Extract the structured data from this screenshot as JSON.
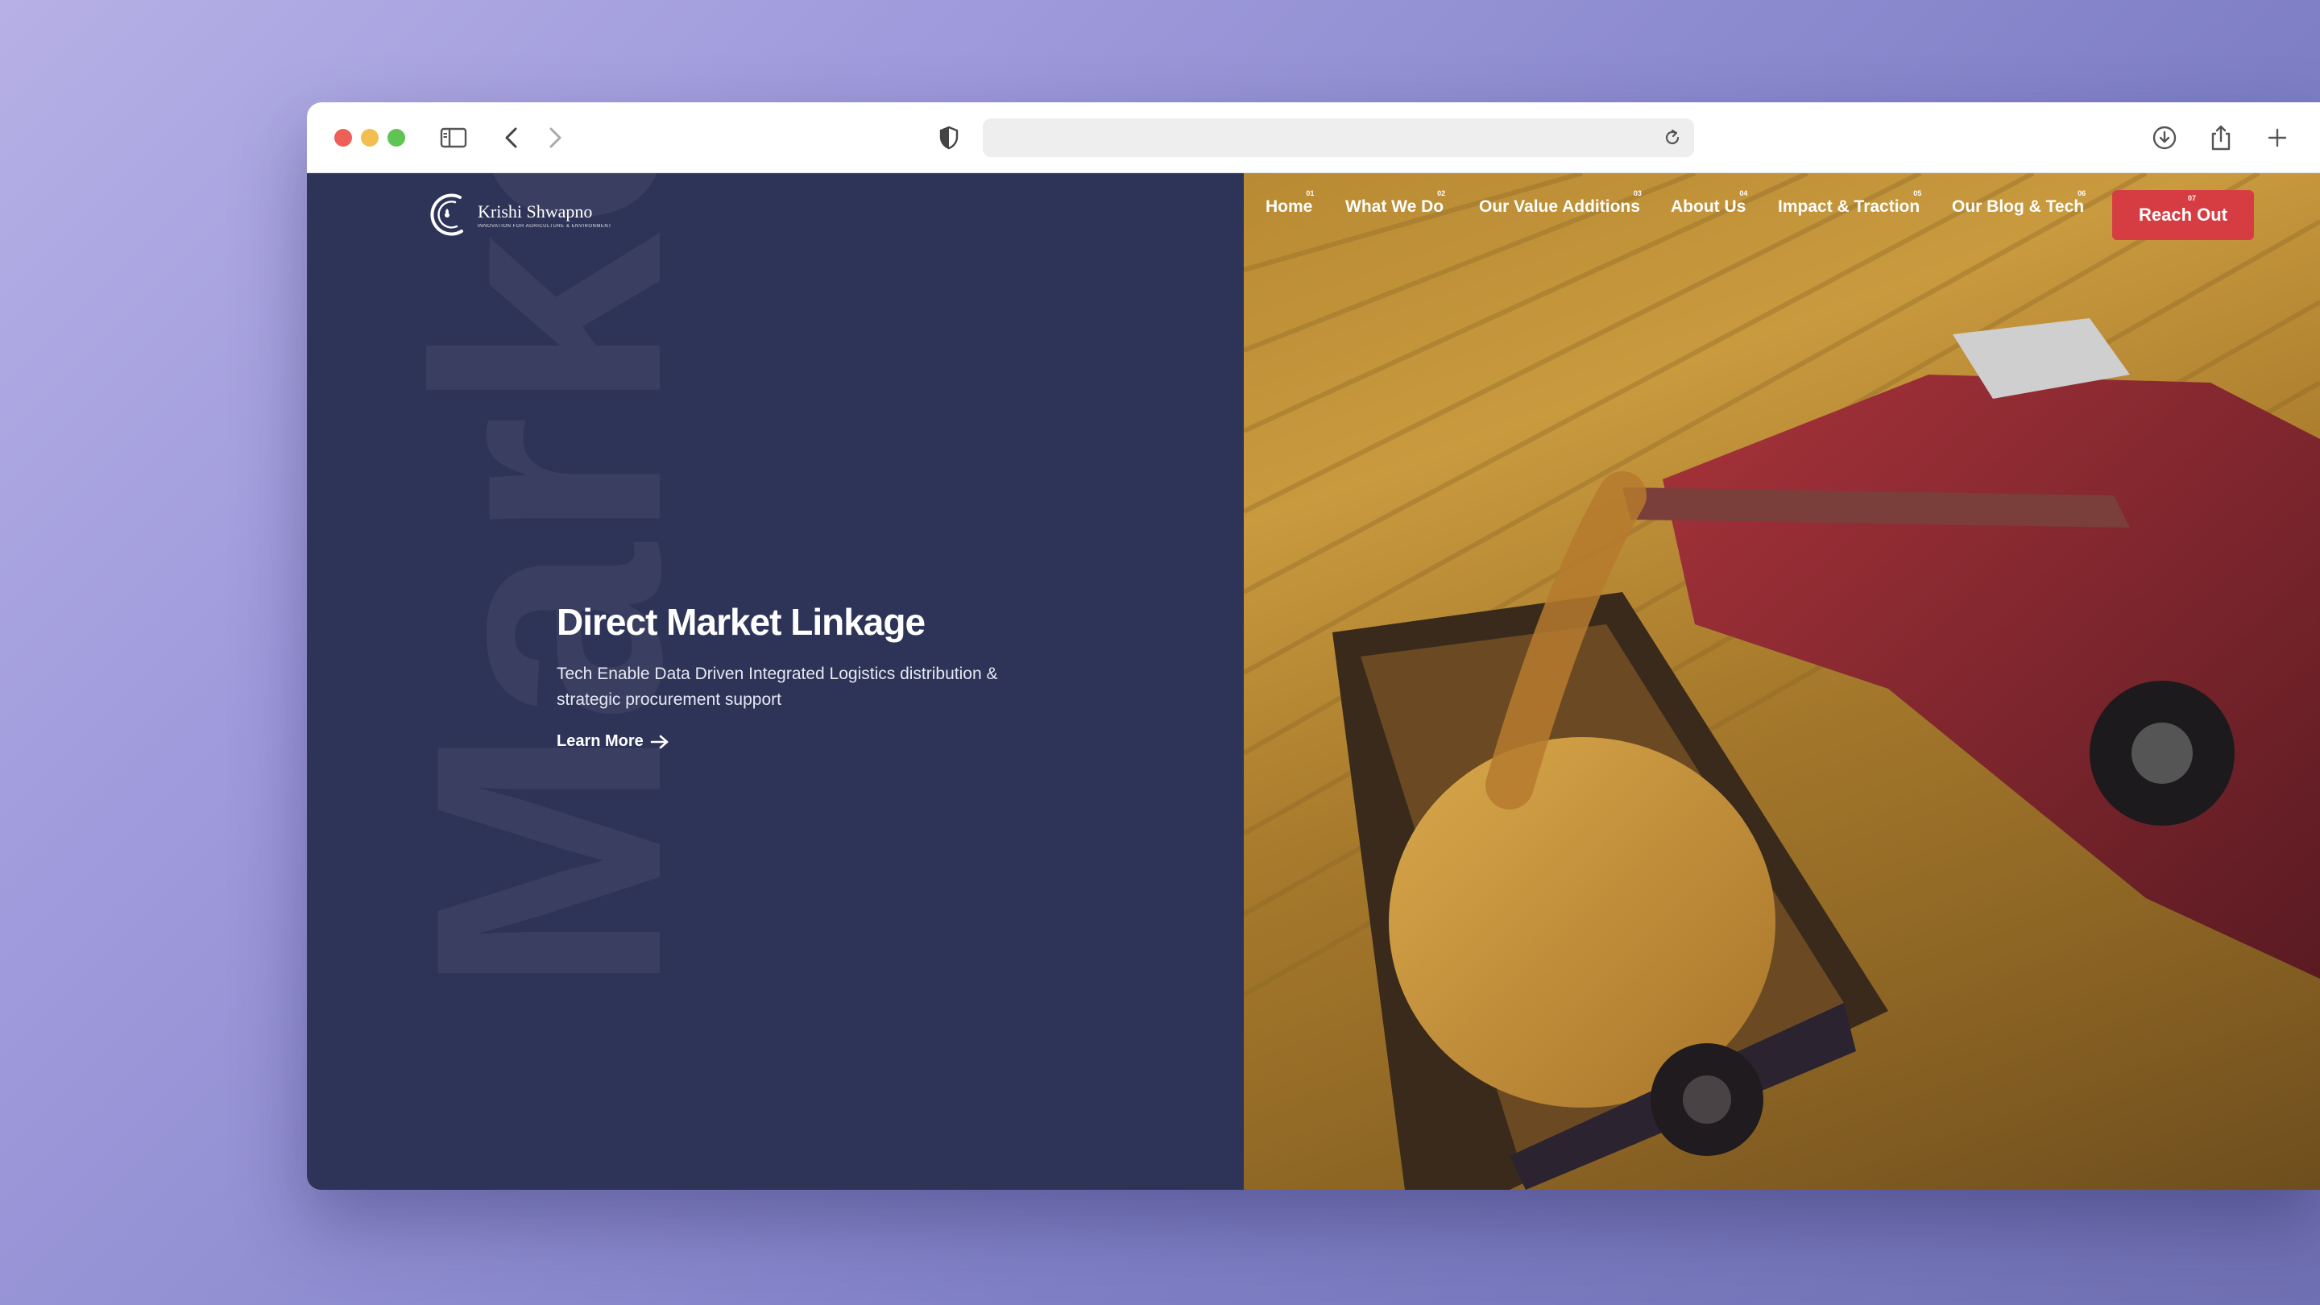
{
  "browser": {
    "url": "",
    "icons": [
      "sidebar-icon",
      "back-icon",
      "forward-icon",
      "shield-icon",
      "reload-icon",
      "download-icon",
      "share-icon",
      "new-tab-icon"
    ]
  },
  "site": {
    "logo_name": "Krishi Shwapno",
    "logo_tagline": "INNOVATION FOR AGRICULTURE & ENVIRONMENT",
    "watermark": "Marke"
  },
  "nav": {
    "items": [
      {
        "num": "01",
        "label": "Home"
      },
      {
        "num": "02",
        "label": "What We Do"
      },
      {
        "num": "03",
        "label": "Our Value Additions"
      },
      {
        "num": "04",
        "label": "About Us"
      },
      {
        "num": "05",
        "label": "Impact & Traction"
      },
      {
        "num": "06",
        "label": "Our Blog & Tech"
      }
    ],
    "cta": {
      "num": "07",
      "label": "Reach Out"
    }
  },
  "hero": {
    "title": "Direct Market Linkage",
    "description": "Tech Enable Data Driven Integrated Logistics distribution & strategic procurement support",
    "link": "Learn More"
  },
  "colors": {
    "panel": "#2e3458",
    "accent": "#d63d43",
    "background_gradient": "#9c98da"
  }
}
